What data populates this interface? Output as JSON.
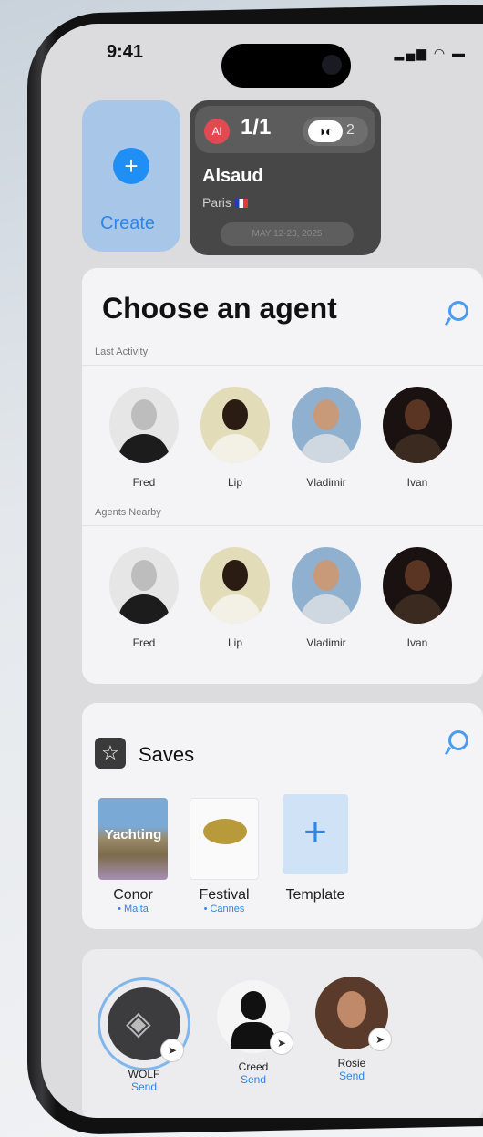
{
  "status": {
    "time": "9:41"
  },
  "create": {
    "label": "Create"
  },
  "trip": {
    "avatar": "Al",
    "count": "1/1",
    "companions": "2",
    "name": "Alsaud",
    "city": "Paris",
    "date": "MAY 12-23, 2025"
  },
  "agents": {
    "title": "Choose an agent",
    "last_activity_label": "Last Activity",
    "nearby_label": "Agents Nearby",
    "last_activity": [
      {
        "name": "Fred"
      },
      {
        "name": "Lip"
      },
      {
        "name": "Vladimir"
      },
      {
        "name": "Ivan"
      }
    ],
    "nearby": [
      {
        "name": "Fred"
      },
      {
        "name": "Lip"
      },
      {
        "name": "Vladimir"
      },
      {
        "name": "Ivan"
      }
    ]
  },
  "saves": {
    "title": "Saves",
    "items": [
      {
        "name": "Conor",
        "sub": "• Malta",
        "thumb_text": "Yachting"
      },
      {
        "name": "Festival",
        "sub": "• Cannes"
      },
      {
        "name": "Template",
        "sub": ""
      }
    ]
  },
  "dock": {
    "items": [
      {
        "name": "WOLF",
        "action": "Send"
      },
      {
        "name": "Creed",
        "action": "Send"
      },
      {
        "name": "Rosie",
        "action": "Send"
      }
    ]
  },
  "colors": {
    "accent": "#2f85e8",
    "create_bg": "#a8c7e8",
    "trip_bg": "#474747"
  }
}
